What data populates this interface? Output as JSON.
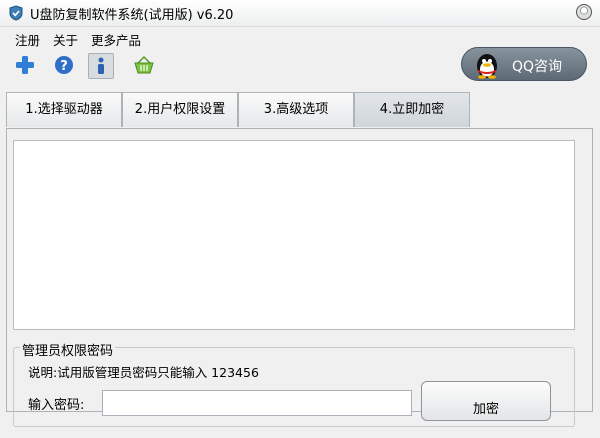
{
  "window": {
    "title": "U盘防复制软件系统(试用版) v6.20"
  },
  "menu": {
    "items": [
      "注册",
      "关于",
      "更多产品"
    ]
  },
  "toolbar": {
    "icons": [
      "plus-icon",
      "help-icon",
      "info-icon",
      "basket-icon"
    ]
  },
  "qq": {
    "label": "QQ咨询"
  },
  "tabs": [
    "1.选择驱动器",
    "2.用户权限设置",
    "3.高级选项",
    "4.立即加密"
  ],
  "active_tab": "4.立即加密",
  "admin": {
    "group_title": "管理员权限密码",
    "hint": "说明:试用版管理员密码只能输入 123456",
    "password_label": "输入密码:",
    "password_value": "",
    "encrypt_button": "加密"
  }
}
